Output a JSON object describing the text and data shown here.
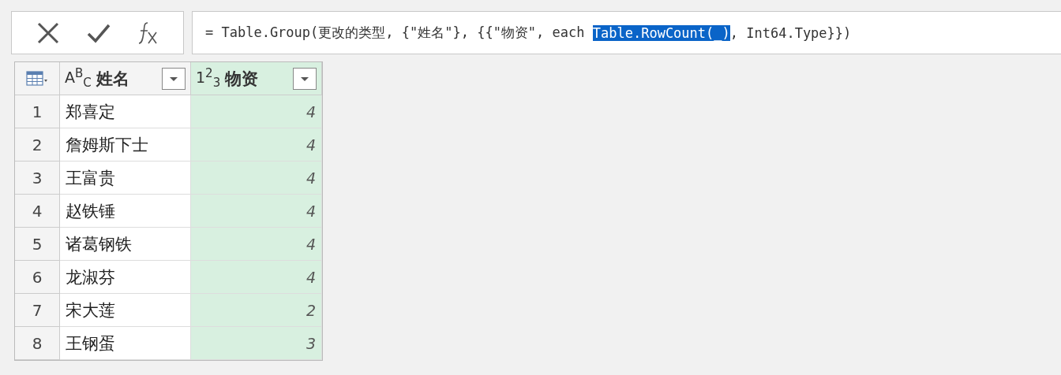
{
  "formula_bar": {
    "formula_before": "= Table.Group(更改的类型, {\"姓名\"}, {{\"物资\", each ",
    "formula_selection": "Table.RowCount(_)",
    "formula_after": ", Int64.Type}})"
  },
  "table": {
    "columns": [
      {
        "type_icon": "A$^{B}$$_{C}$",
        "label": "姓名",
        "kind": "text",
        "selected": false
      },
      {
        "type_icon": "1$^{2}$$_{3}$",
        "label": "物资",
        "kind": "number",
        "selected": true
      }
    ],
    "rows": [
      {
        "index": "1",
        "cells": [
          "郑喜定",
          "4"
        ]
      },
      {
        "index": "2",
        "cells": [
          "詹姆斯下士",
          "4"
        ]
      },
      {
        "index": "3",
        "cells": [
          "王富贵",
          "4"
        ]
      },
      {
        "index": "4",
        "cells": [
          "赵铁锤",
          "4"
        ]
      },
      {
        "index": "5",
        "cells": [
          "诸葛钢铁",
          "4"
        ]
      },
      {
        "index": "6",
        "cells": [
          "龙淑芬",
          "4"
        ]
      },
      {
        "index": "7",
        "cells": [
          "宋大莲",
          "2"
        ]
      },
      {
        "index": "8",
        "cells": [
          "王钢蛋",
          "3"
        ]
      }
    ]
  }
}
